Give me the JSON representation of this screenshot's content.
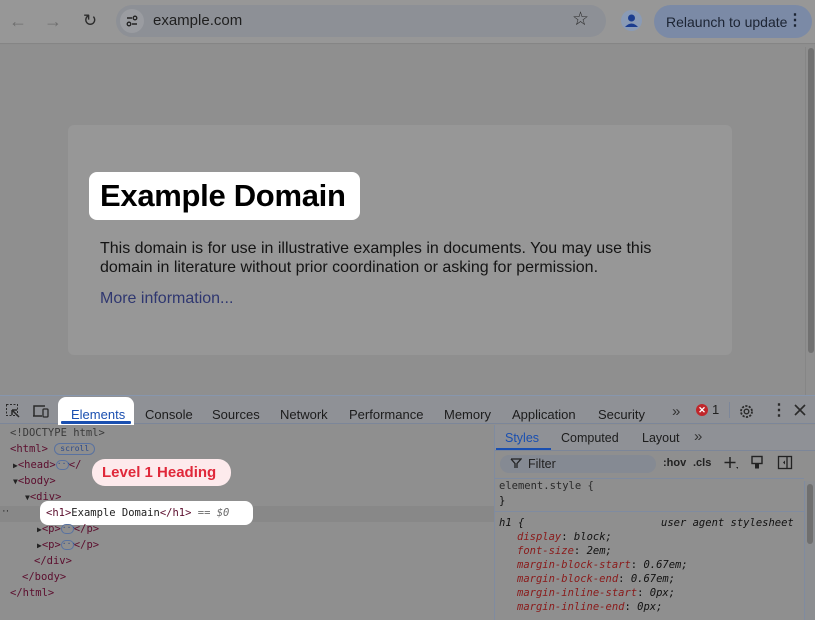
{
  "browser": {
    "url": "example.com",
    "relaunch_label": "Relaunch to update",
    "icons": {
      "back": "←",
      "forward": "→",
      "reload": "↻",
      "site_info": "tune-icon",
      "star": "☆",
      "profile": "person-icon",
      "menu": "⋮"
    }
  },
  "page": {
    "heading": "Example Domain",
    "paragraph": "This domain is for use in illustrative examples in documents. You may use this domain in literature without prior coordination or asking for permission.",
    "link": "More information..."
  },
  "devtools": {
    "tabs": [
      "Elements",
      "Console",
      "Sources",
      "Network",
      "Performance",
      "Memory",
      "Application",
      "Security"
    ],
    "active_tab": "Elements",
    "more_tabs": "»",
    "error_count": "1",
    "error_glyph": "✕",
    "dom": {
      "doctype": "<!DOCTYPE html>",
      "html_open": "<html>",
      "scroll_badge": "scroll",
      "head_open": "<head>",
      "head_close": "</",
      "body_open": "<body>",
      "div_open": "<div>",
      "h1_open": "<h1>",
      "h1_text": "Example Domain",
      "h1_close": "</h1>",
      "selected_suffix": "== $0",
      "p_open": "<p>",
      "p_close": "</p>",
      "div_close": "</div>",
      "body_close": "</body>",
      "html_close": "</html>",
      "ellipsis": "···",
      "row_dots": "··"
    },
    "tooltip": "Level 1 Heading",
    "styles": {
      "tabs": [
        "Styles",
        "Computed",
        "Layout"
      ],
      "active_tab": "Styles",
      "more_tabs": "»",
      "filter_placeholder": "Filter",
      "hov": ":hov",
      "cls": ".cls",
      "element_style_open": "element.style {",
      "element_style_close": "}",
      "rule_selector": "h1 {",
      "rule_source": "user agent stylesheet",
      "declarations": [
        {
          "prop": "display",
          "value": "block;"
        },
        {
          "prop": "font-size",
          "value": "2em;"
        },
        {
          "prop": "margin-block-start",
          "value": "0.67em;"
        },
        {
          "prop": "margin-block-end",
          "value": "0.67em;"
        },
        {
          "prop": "margin-inline-start",
          "value": "0px;"
        },
        {
          "prop": "margin-inline-end",
          "value": "0px;"
        }
      ]
    }
  }
}
